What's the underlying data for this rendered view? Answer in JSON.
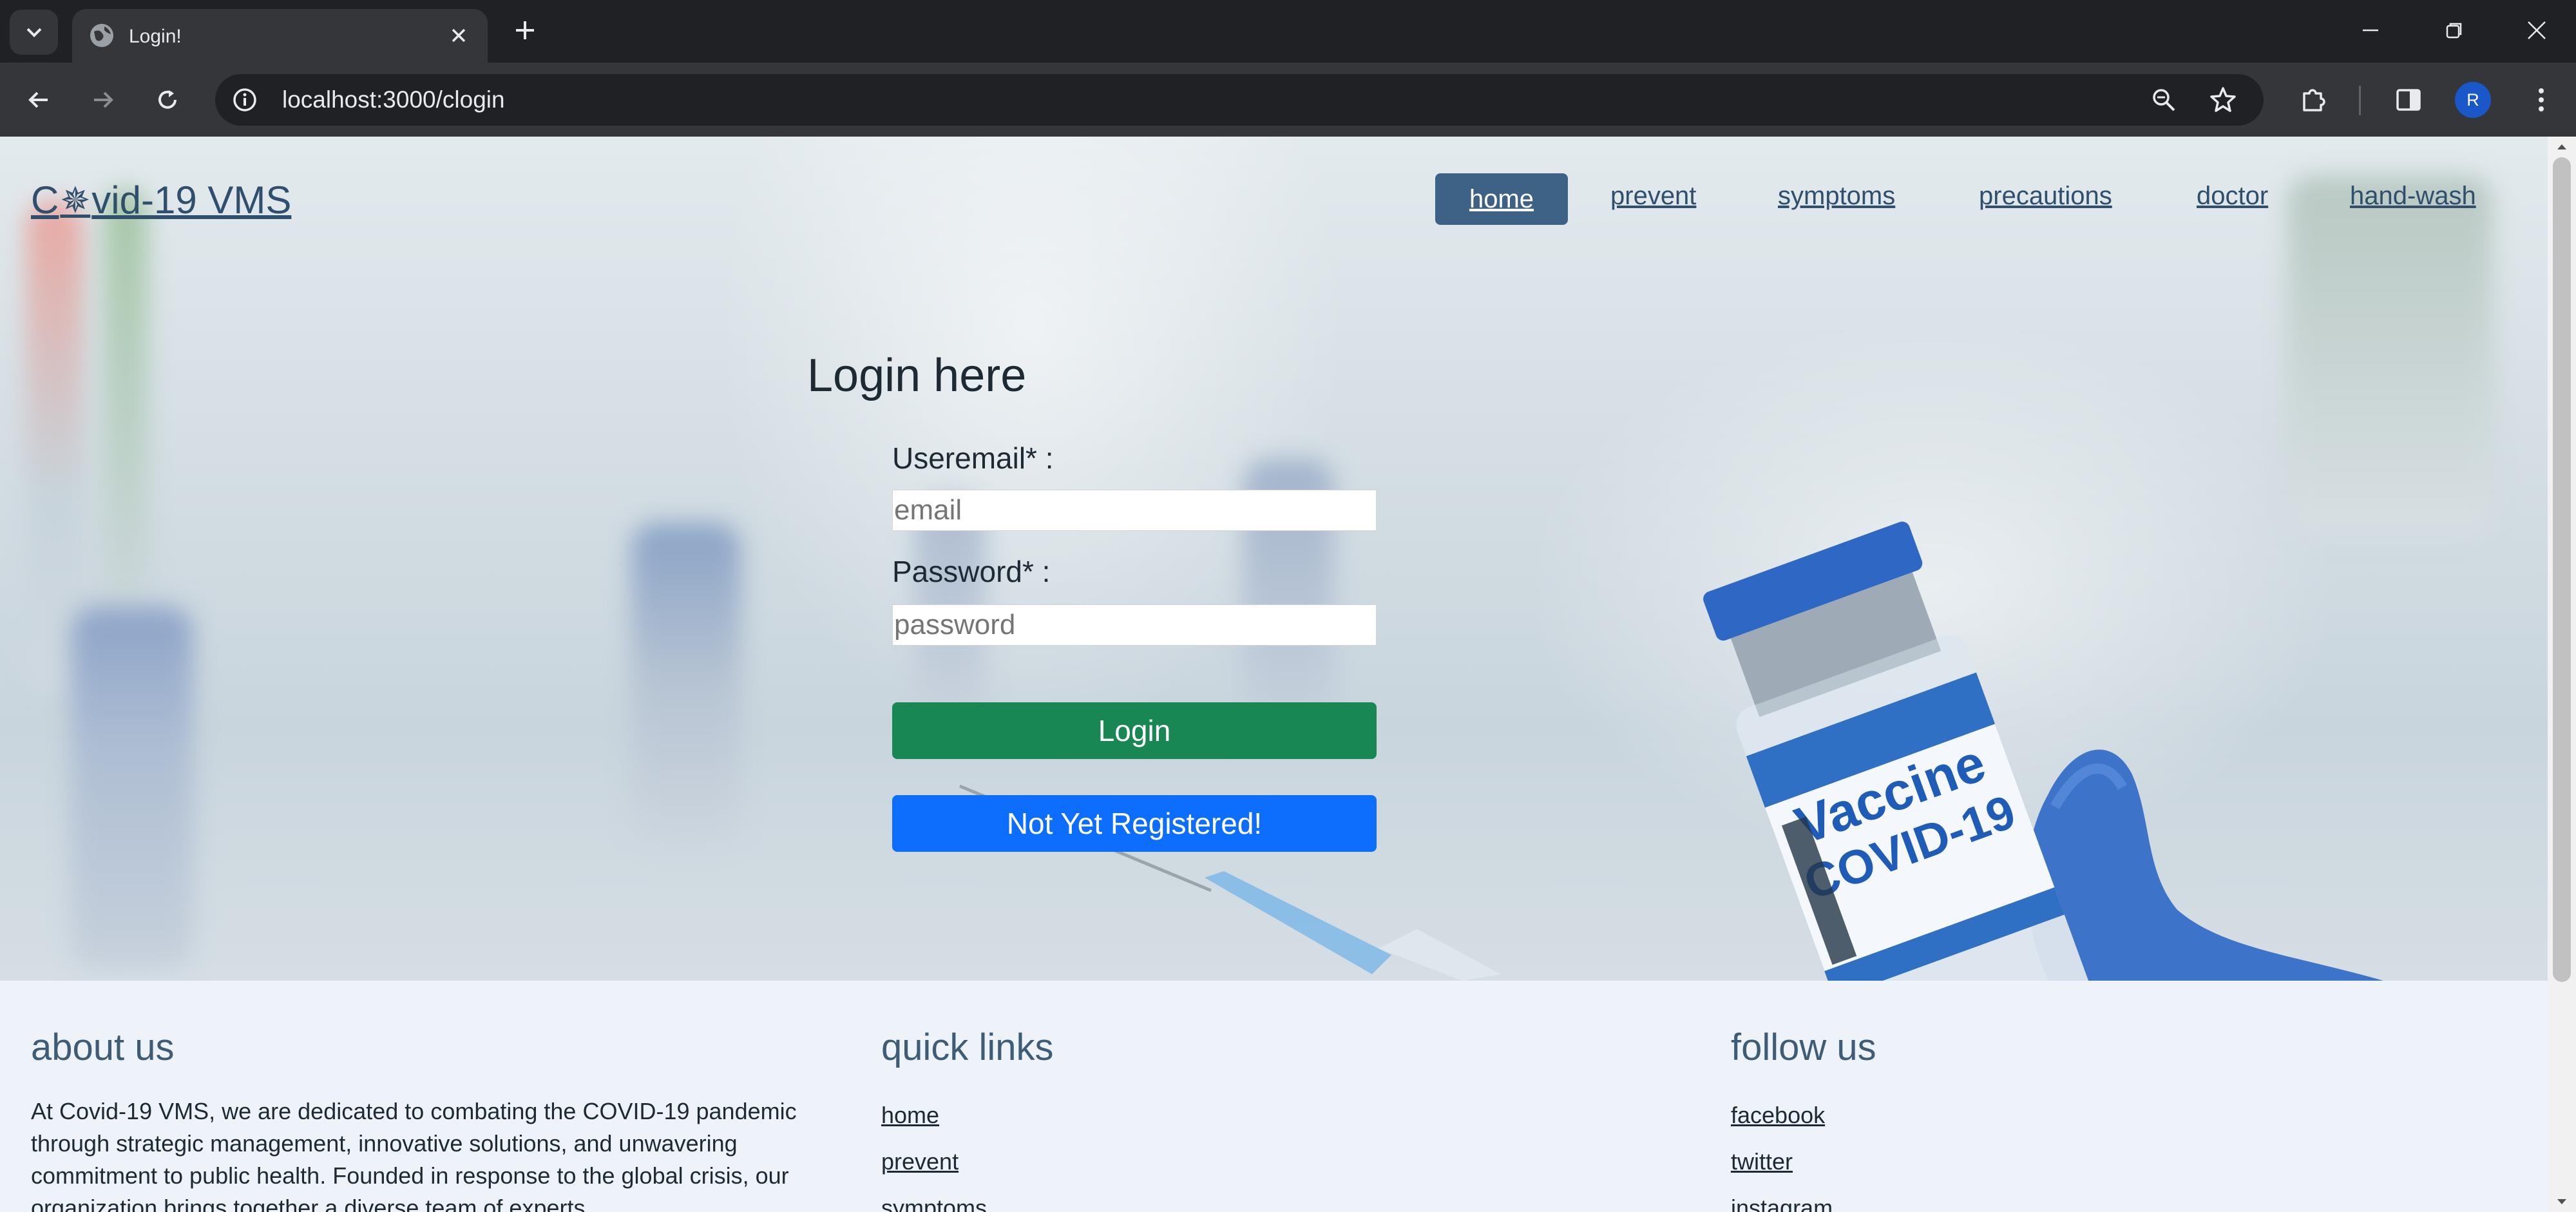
{
  "browser": {
    "tab_title": "Login!",
    "url": "localhost:3000/clogin",
    "profile_initial": "R"
  },
  "site": {
    "logo_prefix": "C",
    "logo_suffix": "vid-19 VMS",
    "nav": {
      "home": "home",
      "prevent": "prevent",
      "symptoms": "symptoms",
      "precautions": "precautions",
      "doctor": "doctor",
      "hand_wash": "hand-wash"
    }
  },
  "login": {
    "title": "Login here",
    "email_label": "Useremail* :",
    "email_placeholder": "email",
    "password_label": "Password* :",
    "password_placeholder": "password",
    "login_button": "Login",
    "register_button": "Not Yet Registered!"
  },
  "vial": {
    "line1": "Vaccine",
    "line2": "COVID-19"
  },
  "footer": {
    "about_title": "about us",
    "about_text": "At Covid-19 VMS, we are dedicated to combating the COVID-19 pandemic through strategic management, innovative solutions, and unwavering commitment to public health. Founded in response to the global crisis, our organization brings together a diverse team of experts",
    "quick_links_title": "quick links",
    "quick_links": [
      "home",
      "prevent",
      "symptoms"
    ],
    "follow_title": "follow us",
    "follow_links": [
      "facebook",
      "twitter",
      "instagram"
    ]
  },
  "colors": {
    "nav_active_bg": "#3e6285",
    "login_button": "#198754",
    "register_button": "#0d6efd",
    "brand_text": "#2f4f6c"
  }
}
